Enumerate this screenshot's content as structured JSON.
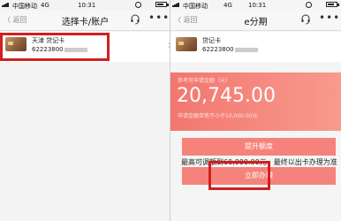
{
  "left": {
    "status": {
      "carrier": "中国移动",
      "network": "4G",
      "time": "10:31"
    },
    "nav": {
      "back": "返回",
      "title": "选择卡/账户"
    },
    "card": {
      "name": "天津  贷记卡",
      "number": "62223800"
    }
  },
  "right": {
    "status": {
      "carrier": "中国移动",
      "network": "4G",
      "time": "10:31"
    },
    "nav": {
      "back": "返回",
      "title": "e分期"
    },
    "card": {
      "name": "贷记卡",
      "number": "62223800"
    },
    "quota": {
      "label": "参考可申请金额（元）",
      "amount": "20,745.00",
      "min_note": "申请金额单笔不小于10,000.00元"
    },
    "raise_label": "提升额度",
    "note": "最高可调额到60,000.00元，最终以出卡办理为准",
    "apply_label": "立即办理"
  },
  "colors": {
    "accent": "#f2776f",
    "highlight_box": "#d21f1f"
  },
  "icons": [
    "signal-icon",
    "battery-icon",
    "alarm-icon",
    "back-chevron-icon",
    "headset-icon",
    "more-icon",
    "chevron-right-icon",
    "bank-card-icon"
  ]
}
